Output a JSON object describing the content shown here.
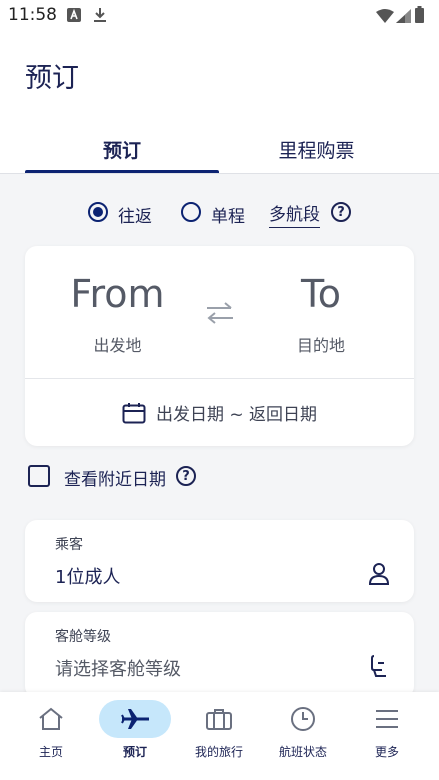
{
  "status_bar": {
    "time": "11:58"
  },
  "header": {
    "title": "预订",
    "tabs": [
      {
        "label": "预订"
      },
      {
        "label": "里程购票"
      }
    ]
  },
  "trip_type": {
    "round_trip": "往返",
    "one_way": "单程",
    "multi_city": "多航段",
    "help": "?"
  },
  "route": {
    "from_label": "From",
    "from_sub": "出发地",
    "to_label": "To",
    "to_sub": "目的地",
    "dates": "出发日期 ~ 返回日期"
  },
  "nearby_dates": {
    "label": "查看附近日期",
    "help": "?"
  },
  "passengers": {
    "label": "乘客",
    "value": "1位成人"
  },
  "cabin": {
    "label": "客舱等级",
    "placeholder": "请选择客舱等级"
  },
  "bottom_nav": [
    {
      "label": "主页",
      "icon": "home-icon"
    },
    {
      "label": "预订",
      "icon": "plane-icon"
    },
    {
      "label": "我的旅行",
      "icon": "briefcase-icon"
    },
    {
      "label": "航班状态",
      "icon": "clock-icon"
    },
    {
      "label": "更多",
      "icon": "menu-icon"
    }
  ],
  "colors": {
    "accent": "#0c2372",
    "nav_active_bg": "#c6e7fb",
    "background": "#f4f5f7"
  }
}
